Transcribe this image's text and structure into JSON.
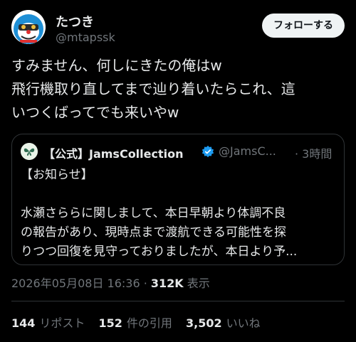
{
  "author": {
    "name": "たつき",
    "handle": "@mtapssk",
    "avatar_icon": "doraemon-avatar-icon"
  },
  "follow_button": {
    "label": "フォローする"
  },
  "tweet": {
    "text": "すみません、何しにきたの俺はw\n飛行機取り直してまで辿り着いたらこれ、這\nいつくばってでも来いやw"
  },
  "quote": {
    "avatar_icon": "butterfly-logo-icon",
    "name": "【公式】JamsCollection",
    "verified_icon": "verified-badge-icon",
    "handle": "@JamsC...",
    "time": "· 3時間",
    "text": "【お知らせ】\n\n水瀬さららに関しまして、本日早朝より体調不良\nの報告があり、現時点まで渡航できる可能性を探\nりつつ回復を見守っておりましたが、本日より予..."
  },
  "meta": {
    "timestamp": "2026年05月08日 16:36",
    "separator": " · ",
    "views_count": "312K",
    "views_label": " 表示"
  },
  "stats": {
    "reposts_count": "144",
    "reposts_label": "リポスト",
    "quotes_count": "152",
    "quotes_label": "件の引用",
    "likes_count": "3,502",
    "likes_label": "いいね"
  },
  "colors": {
    "background": "#000000",
    "text": "#e7e9ea",
    "muted": "#71767b",
    "border": "#2f3336",
    "verified": "#1d9bf0"
  }
}
